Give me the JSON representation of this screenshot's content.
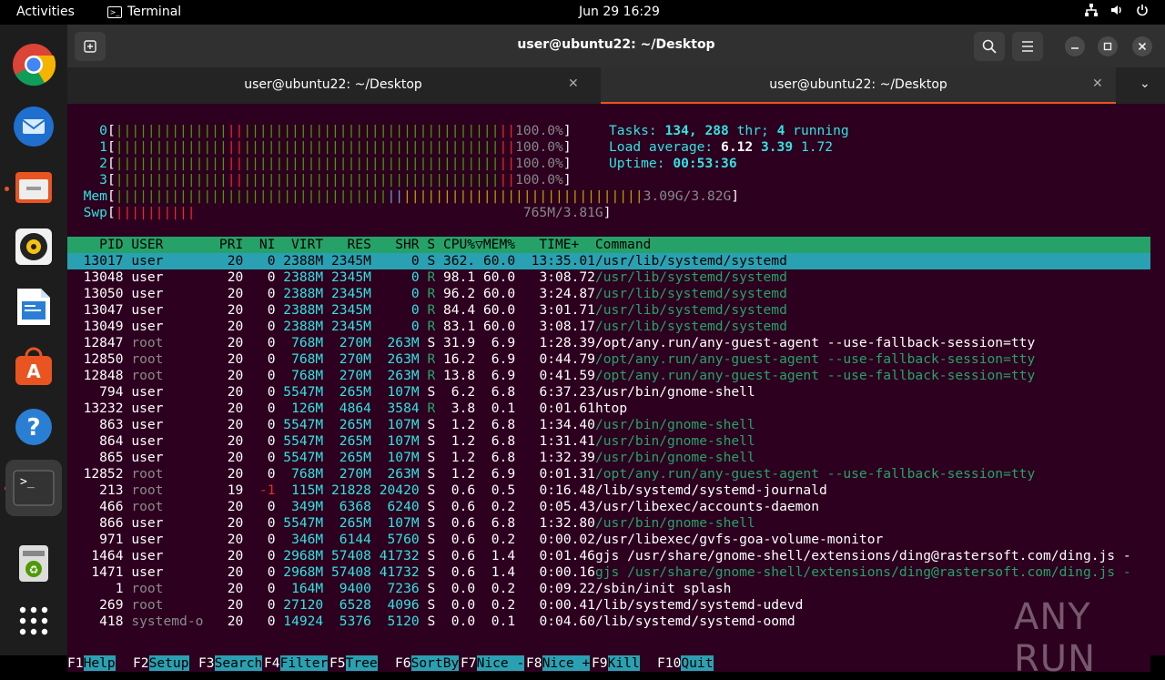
{
  "topbar": {
    "activities": "Activities",
    "app_name": "Terminal",
    "clock": "Jun 29  16:29",
    "tray_icons": [
      "network-icon",
      "volume-icon",
      "power-icon"
    ]
  },
  "dock": {
    "items": [
      "chrome-icon",
      "thunderbird-icon",
      "files-icon",
      "rhythmbox-icon",
      "writer-icon",
      "app-center-icon",
      "help-icon",
      "terminal-icon",
      "trash-icon",
      "show-apps-icon"
    ]
  },
  "window": {
    "title": "user@ubuntu22: ~/Desktop",
    "tabs": [
      {
        "label": "user@ubuntu22: ~/Desktop"
      },
      {
        "label": "user@ubuntu22: ~/Desktop"
      }
    ]
  },
  "htop": {
    "cpus": [
      {
        "id": "0",
        "pct": "100.0%"
      },
      {
        "id": "1",
        "pct": "100.0%"
      },
      {
        "id": "2",
        "pct": "100.0%"
      },
      {
        "id": "3",
        "pct": "100.0%"
      }
    ],
    "mem": {
      "label": "Mem",
      "value": "3.09G/3.82G"
    },
    "swp": {
      "label": "Swp",
      "value": "765M/3.81G"
    },
    "tasks_label": "Tasks:",
    "tasks": "134,",
    "threads": "288",
    "thr_label": "thr;",
    "running": "4",
    "running_label": "running",
    "load_label": "Load average:",
    "load1": "6.12",
    "load5": "3.39",
    "load15": "1.72",
    "uptime_label": "Uptime:",
    "uptime": "00:53:36",
    "columns": "    PID USER       PRI  NI  VIRT   RES   SHR S CPU%▽MEM%   TIME+  Command",
    "rows": [
      {
        "pid": "13017",
        "user": "user",
        "pri": "20",
        "ni": "0",
        "virt": "2388M",
        "res": "2345M",
        "shr": "0",
        "s": "S",
        "cpu": "362.",
        "mem": "60.0",
        "time": "13:35.01",
        "cmd": "/usr/lib/systemd/systemd",
        "sel": true
      },
      {
        "pid": "13048",
        "user": "user",
        "pri": "20",
        "ni": "0",
        "virt": "2388M",
        "res": "2345M",
        "shr": "0",
        "s": "R",
        "cpu": "98.1",
        "mem": "60.0",
        "time": "3:08.72",
        "cmd": "/usr/lib/systemd/systemd",
        "thread": true
      },
      {
        "pid": "13050",
        "user": "user",
        "pri": "20",
        "ni": "0",
        "virt": "2388M",
        "res": "2345M",
        "shr": "0",
        "s": "R",
        "cpu": "96.2",
        "mem": "60.0",
        "time": "3:24.87",
        "cmd": "/usr/lib/systemd/systemd",
        "thread": true
      },
      {
        "pid": "13047",
        "user": "user",
        "pri": "20",
        "ni": "0",
        "virt": "2388M",
        "res": "2345M",
        "shr": "0",
        "s": "R",
        "cpu": "84.4",
        "mem": "60.0",
        "time": "3:01.71",
        "cmd": "/usr/lib/systemd/systemd",
        "thread": true
      },
      {
        "pid": "13049",
        "user": "user",
        "pri": "20",
        "ni": "0",
        "virt": "2388M",
        "res": "2345M",
        "shr": "0",
        "s": "R",
        "cpu": "83.1",
        "mem": "60.0",
        "time": "3:08.17",
        "cmd": "/usr/lib/systemd/systemd",
        "thread": true
      },
      {
        "pid": "12847",
        "user": "root",
        "pri": "20",
        "ni": "0",
        "virt": "768M",
        "res": "270M",
        "shr": "263M",
        "s": "S",
        "cpu": "31.9",
        "mem": "6.9",
        "time": "1:28.39",
        "cmd": "/opt/any.run/any-guest-agent --use-fallback-session=tty"
      },
      {
        "pid": "12850",
        "user": "root",
        "pri": "20",
        "ni": "0",
        "virt": "768M",
        "res": "270M",
        "shr": "263M",
        "s": "R",
        "cpu": "16.2",
        "mem": "6.9",
        "time": "0:44.79",
        "cmd": "/opt/any.run/any-guest-agent --use-fallback-session=tty",
        "thread": true
      },
      {
        "pid": "12848",
        "user": "root",
        "pri": "20",
        "ni": "0",
        "virt": "768M",
        "res": "270M",
        "shr": "263M",
        "s": "R",
        "cpu": "13.8",
        "mem": "6.9",
        "time": "0:41.59",
        "cmd": "/opt/any.run/any-guest-agent --use-fallback-session=tty",
        "thread": true
      },
      {
        "pid": "794",
        "user": "user",
        "pri": "20",
        "ni": "0",
        "virt": "5547M",
        "res": "265M",
        "shr": "107M",
        "s": "S",
        "cpu": "6.2",
        "mem": "6.8",
        "time": "6:37.23",
        "cmd": "/usr/bin/gnome-shell"
      },
      {
        "pid": "13232",
        "user": "user",
        "pri": "20",
        "ni": "0",
        "virt": "126M",
        "res": "4864",
        "shr": "3584",
        "s": "R",
        "cpu": "3.8",
        "mem": "0.1",
        "time": "0:01.61",
        "cmd": "htop"
      },
      {
        "pid": "863",
        "user": "user",
        "pri": "20",
        "ni": "0",
        "virt": "5547M",
        "res": "265M",
        "shr": "107M",
        "s": "S",
        "cpu": "1.2",
        "mem": "6.8",
        "time": "1:34.40",
        "cmd": "/usr/bin/gnome-shell",
        "thread": true
      },
      {
        "pid": "864",
        "user": "user",
        "pri": "20",
        "ni": "0",
        "virt": "5547M",
        "res": "265M",
        "shr": "107M",
        "s": "S",
        "cpu": "1.2",
        "mem": "6.8",
        "time": "1:31.41",
        "cmd": "/usr/bin/gnome-shell",
        "thread": true
      },
      {
        "pid": "865",
        "user": "user",
        "pri": "20",
        "ni": "0",
        "virt": "5547M",
        "res": "265M",
        "shr": "107M",
        "s": "S",
        "cpu": "1.2",
        "mem": "6.8",
        "time": "1:32.39",
        "cmd": "/usr/bin/gnome-shell",
        "thread": true
      },
      {
        "pid": "12852",
        "user": "root",
        "pri": "20",
        "ni": "0",
        "virt": "768M",
        "res": "270M",
        "shr": "263M",
        "s": "S",
        "cpu": "1.2",
        "mem": "6.9",
        "time": "0:01.31",
        "cmd": "/opt/any.run/any-guest-agent --use-fallback-session=tty",
        "thread": true
      },
      {
        "pid": "213",
        "user": "root",
        "pri": "19",
        "ni": "-1",
        "virt": "115M",
        "res": "21828",
        "shr": "20420",
        "s": "S",
        "cpu": "0.6",
        "mem": "0.5",
        "time": "0:16.48",
        "cmd": "/lib/systemd/systemd-journald"
      },
      {
        "pid": "466",
        "user": "root",
        "pri": "20",
        "ni": "0",
        "virt": "349M",
        "res": "6368",
        "shr": "6240",
        "s": "S",
        "cpu": "0.6",
        "mem": "0.2",
        "time": "0:05.43",
        "cmd": "/usr/libexec/accounts-daemon"
      },
      {
        "pid": "866",
        "user": "user",
        "pri": "20",
        "ni": "0",
        "virt": "5547M",
        "res": "265M",
        "shr": "107M",
        "s": "S",
        "cpu": "0.6",
        "mem": "6.8",
        "time": "1:32.80",
        "cmd": "/usr/bin/gnome-shell",
        "thread": true
      },
      {
        "pid": "971",
        "user": "user",
        "pri": "20",
        "ni": "0",
        "virt": "346M",
        "res": "6144",
        "shr": "5760",
        "s": "S",
        "cpu": "0.6",
        "mem": "0.2",
        "time": "0:00.02",
        "cmd": "/usr/libexec/gvfs-goa-volume-monitor"
      },
      {
        "pid": "1464",
        "user": "user",
        "pri": "20",
        "ni": "0",
        "virt": "2968M",
        "res": "57408",
        "shr": "41732",
        "s": "S",
        "cpu": "0.6",
        "mem": "1.4",
        "time": "0:01.46",
        "cmd": "gjs /usr/share/gnome-shell/extensions/ding@rastersoft.com/ding.js -"
      },
      {
        "pid": "1471",
        "user": "user",
        "pri": "20",
        "ni": "0",
        "virt": "2968M",
        "res": "57408",
        "shr": "41732",
        "s": "S",
        "cpu": "0.6",
        "mem": "1.4",
        "time": "0:00.16",
        "cmd": "gjs /usr/share/gnome-shell/extensions/ding@rastersoft.com/ding.js -",
        "thread": true
      },
      {
        "pid": "1",
        "user": "root",
        "pri": "20",
        "ni": "0",
        "virt": "164M",
        "res": "9400",
        "shr": "7236",
        "s": "S",
        "cpu": "0.0",
        "mem": "0.2",
        "time": "0:09.22",
        "cmd": "/sbin/init splash"
      },
      {
        "pid": "269",
        "user": "root",
        "pri": "20",
        "ni": "0",
        "virt": "27120",
        "res": "6528",
        "shr": "4096",
        "s": "S",
        "cpu": "0.0",
        "mem": "0.2",
        "time": "0:00.41",
        "cmd": "/lib/systemd/systemd-udevd"
      },
      {
        "pid": "418",
        "user": "systemd-o",
        "pri": "20",
        "ni": "0",
        "virt": "14924",
        "res": "5376",
        "shr": "5120",
        "s": "S",
        "cpu": "0.0",
        "mem": "0.1",
        "time": "0:04.60",
        "cmd": "/lib/systemd/systemd-oomd"
      }
    ],
    "fkeys": [
      {
        "k": "F1",
        "n": "Help  "
      },
      {
        "k": "F2",
        "n": "Setup "
      },
      {
        "k": "F3",
        "n": "Search"
      },
      {
        "k": "F4",
        "n": "Filter"
      },
      {
        "k": "F5",
        "n": "Tree  "
      },
      {
        "k": "F6",
        "n": "SortBy"
      },
      {
        "k": "F7",
        "n": "Nice -"
      },
      {
        "k": "F8",
        "n": "Nice +"
      },
      {
        "k": "F9",
        "n": "Kill  "
      },
      {
        "k": "F10",
        "n": "Quit"
      }
    ]
  },
  "watermark": "ANY RUN"
}
